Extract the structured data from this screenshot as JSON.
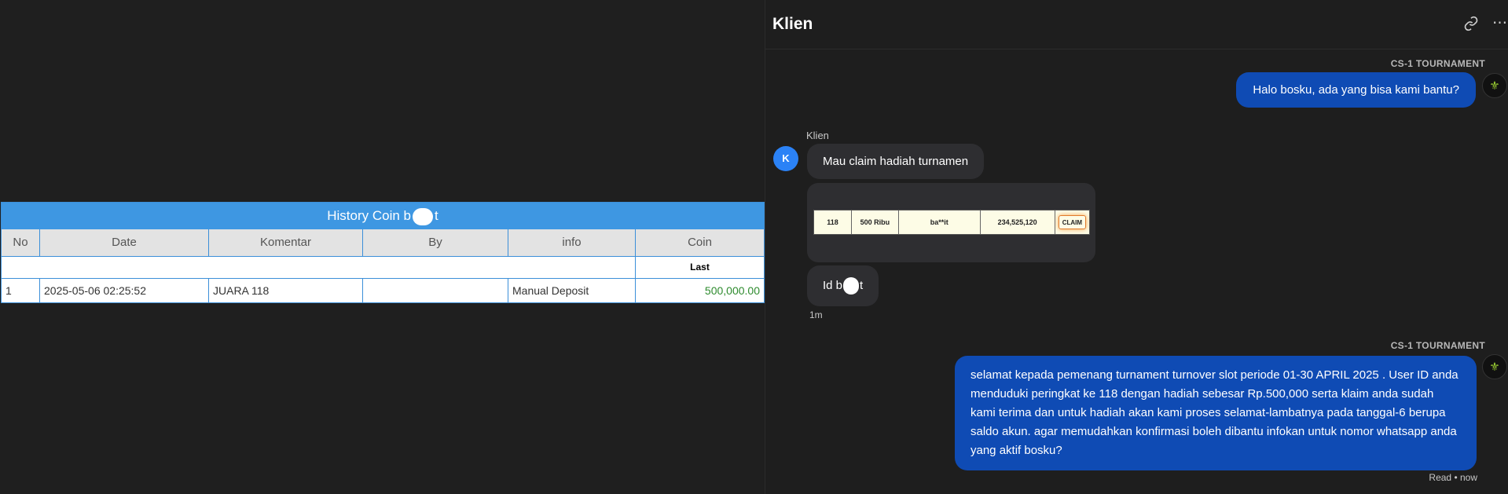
{
  "coin_table": {
    "title": "History Coin b",
    "title_suffix": "t",
    "columns": [
      "No",
      "Date",
      "Komentar",
      "By",
      "info",
      "Coin"
    ],
    "subheader": "Last",
    "rows": [
      {
        "no": "1",
        "date": "2025-05-06 02:25:52",
        "komentar": "JUARA 118",
        "by": "",
        "info": "Manual Deposit",
        "coin": "500,000.00"
      }
    ]
  },
  "chat": {
    "title": "Klien",
    "agent_name": "CS-1 TOURNAMENT",
    "client_name": "Klien",
    "client_initial": "K",
    "messages": {
      "greeting": "Halo bosku, ada yang bisa kami bantu?",
      "claim": "Mau claim hadiah turnamen",
      "id_prefix": "Id b",
      "id_suffix": "t",
      "client_time": "1m",
      "reply": "selamat kepada pemenang turnament turnover slot periode 01-30 APRIL 2025 . User ID anda menduduki peringkat ke 118 dengan hadiah sebesar Rp.500,000 serta klaim anda sudah kami terima dan untuk hadiah akan kami proses selamat-lambatnya pada tanggal-6 berupa saldo akun. agar memudahkan konfirmasi boleh dibantu infokan untuk nomor whatsapp anda yang aktif bosku?",
      "read_status": "Read • now"
    },
    "image_row": [
      "118",
      "500 Ribu",
      "ba**it",
      "234,525,120",
      "CLAIM"
    ]
  },
  "icons": {
    "link": "link-icon",
    "more": "more-icon",
    "agent_logo": "agent-logo-icon"
  }
}
